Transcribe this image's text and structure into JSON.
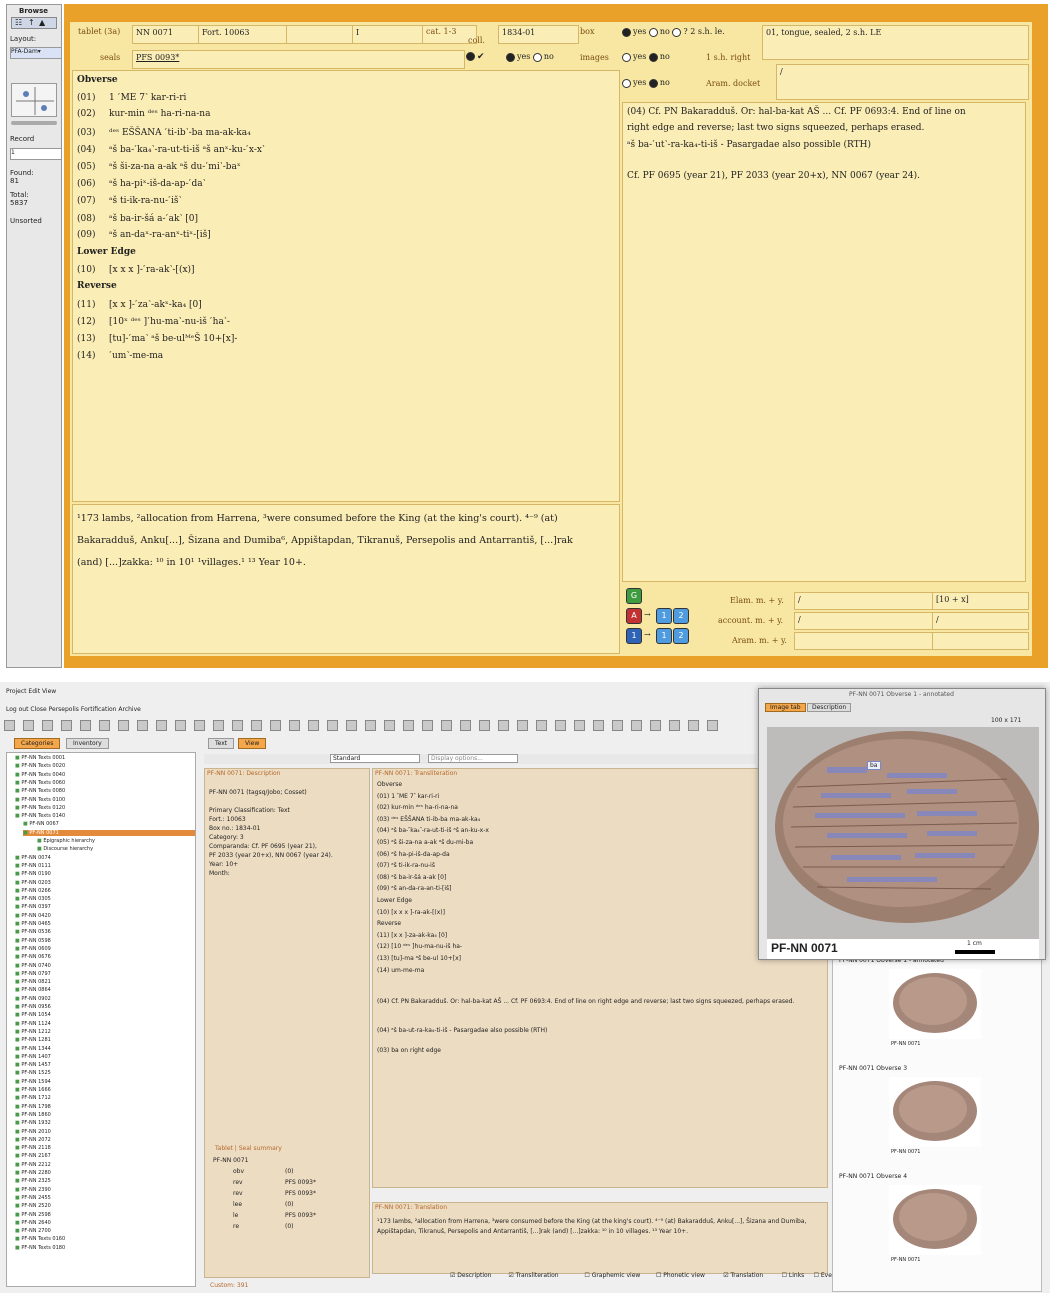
{
  "top": {
    "sidebar": {
      "browse": "Browse",
      "layout": "Layout:",
      "layout_value": "PFA-Dam▾",
      "record": "Record",
      "record_value": "1",
      "found_label": "Found:",
      "found_value": "81",
      "total_label": "Total:",
      "total_value": "5837",
      "unsorted": "Unsorted"
    },
    "header": {
      "tablet_label": "tablet (3a)",
      "tablet_value": "NN 0071",
      "fort_value": "Fort. 10063",
      "i_value": "I",
      "cat_label": "cat. 1-3",
      "coll_label": "coll.",
      "date_value": "1834-01",
      "box_label": "box",
      "seals_label": "seals",
      "seals_value": "PFS 0093*",
      "images_label": "images",
      "yes": "yes",
      "no": "no",
      "q2sh": "? 2 s.h. le.",
      "right_desc": "01, tongue, sealed, 2 s.h. LE",
      "one_sh_right": "1 s.h. right",
      "aram_docket": "Aram. docket",
      "aram_value": "/"
    },
    "transliteration": [
      {
        "n": "Obverse",
        "t": "",
        "h": true
      },
      {
        "n": "(01)",
        "t": "1 ˹ME 7˺ kar-ri-ri"
      },
      {
        "n": "(02)",
        "t": "kur-min ᵈᵉˢ ha-ri-na-na"
      },
      {
        "n": "(03)",
        "t": "ᵈᵉˢ EŠŠANA ˹ti-ib˺-ba ma-ak-ka₄"
      },
      {
        "n": "(04)",
        "t": "ᵃš ba-˹ka₄˺-ra-ut-ti-iš ᵃš anˣ-ku-˹x-x˺"
      },
      {
        "n": "(05)",
        "t": "ᵃš ši-za-na a-ak ᵃš du-˹mi˺-baˣ"
      },
      {
        "n": "(06)",
        "t": "ᵃš ha-piˣ-iš-da-ap-˹da˺"
      },
      {
        "n": "(07)",
        "t": "ᵃš ti-ik-ra-nu-˹iš˺"
      },
      {
        "n": "(08)",
        "t": "ᵃš ba-ir-šá a-˹ak˺ [0]"
      },
      {
        "n": "(09)",
        "t": "ᵃš an-daˣ-ra-anˣ-tiˣ-[iš]"
      },
      {
        "n": "Lower Edge",
        "t": "",
        "h": true
      },
      {
        "n": "(10)",
        "t": "[x x x ]-˹ra-ak˺-[(x)]"
      },
      {
        "n": "Reverse",
        "t": "",
        "h": true
      },
      {
        "n": "(11)",
        "t": "[x x ]-˹za˺-akˣ-ka₄ [0]"
      },
      {
        "n": "(12)",
        "t": "[10ˣ ᵈᵉˢ ]˹hu-ma˺-nu-iš ˹ha˺-"
      },
      {
        "n": "(13)",
        "t": "[tu]-˹ma˺ ᵃš be-ulᴹᵉŠ 10+[x]-"
      },
      {
        "n": "(14)",
        "t": "˹um˺-me-ma"
      }
    ],
    "translation": [
      "¹173 lambs, ²allocation from Harrena, ³were consumed before the King (at the king's court). ⁴⁻⁹ (at)",
      "Bakaradduš, Anku[...], Šizana and Dumiba⁶, Appištapdan, Tikranuš, Persepolis and Antarrantiš, [...]rak",
      "(and) [...]zakka: ¹⁰ in 10¹ ¹villages.¹ ¹³ Year 10+."
    ],
    "notes": [
      "(04) Cf. PN Bakaradduš. Or: hal-ba-kat AŠ ... Cf. PF 0693:4. End of line on",
      "right edge and reverse; last two signs squeezed, perhaps erased.",
      "ᵃš ba-˹ut˺-ra-ka₄-ti-iš - Pasargadae also possible (RTH)",
      "",
      "Cf. PF 0695 (year 21), PF 2033 (year 20+x), NN 0067 (year 24)."
    ],
    "counts": {
      "elam_label": "Elam. m. + y.",
      "elam_value": "/",
      "elam_right": "[10 + x]",
      "account_label": "account. m. + y.",
      "account_value": "/",
      "account_right": "/",
      "aram_label": "Aram. m. + y.",
      "aram_value": ""
    },
    "buttons": {
      "g": "G",
      "a": "A",
      "b": "1",
      "one": "1",
      "two": "2"
    }
  },
  "bottom": {
    "menubar": "Project   Edit   View",
    "toolbar2": "Log out     Close Persepolis Fortification Archive",
    "tabs": [
      "Categories",
      "Inventory"
    ],
    "subtabs": [
      "Text",
      "View"
    ],
    "dropdown": "Standard",
    "search_placeholder": "Display options...",
    "tree_items": [
      "PF-NN Texts 0001",
      "PF-NN Texts 0020",
      "PF-NN Texts 0040",
      "PF-NN Texts 0060",
      "PF-NN Texts 0080",
      "PF-NN Texts 0100",
      "PF-NN Texts 0120",
      "PF-NN Texts 0140",
      "PF-NN 0067",
      "PF-NN 0071",
      "Epigraphic hierarchy",
      "Discourse hierarchy",
      "PF-NN 0074",
      "PF-NN 0111",
      "PF-NN 0190",
      "PF-NN 0203",
      "PF-NN 0266",
      "PF-NN 0305",
      "PF-NN 0397",
      "PF-NN 0420",
      "PF-NN 0465",
      "PF-NN 0536",
      "PF-NN 0598",
      "PF-NN 0609",
      "PF-NN 0676",
      "PF-NN 0740",
      "PF-NN 0797",
      "PF-NN 0821",
      "PF-NN 0864",
      "PF-NN 0902",
      "PF-NN 0956",
      "PF-NN 1054",
      "PF-NN 1124",
      "PF-NN 1212",
      "PF-NN 1281",
      "PF-NN 1344",
      "PF-NN 1407",
      "PF-NN 1457",
      "PF-NN 1525",
      "PF-NN 1594",
      "PF-NN 1666",
      "PF-NN 1712",
      "PF-NN 1798",
      "PF-NN 1860",
      "PF-NN 1932",
      "PF-NN 2010",
      "PF-NN 2072",
      "PF-NN 2118",
      "PF-NN 2167",
      "PF-NN 2212",
      "PF-NN 2280",
      "PF-NN 2325",
      "PF-NN 2390",
      "PF-NN 2455",
      "PF-NN 2520",
      "PF-NN 2598",
      "PF-NN 2640",
      "PF-NN 2700",
      "PF-NN Texts 0160",
      "PF-NN Texts 0180"
    ],
    "left_panel_title": "PF-NN 0071: Description",
    "left_panel_lines": [
      "PF-NN 0071 (tagsq/Jobo; Cosset)",
      "",
      "Primary Classification: Text",
      "  Fort.: 10063",
      "  Box no.: 1834-01",
      "  Category: 3",
      "  Comparanda: Cf. PF 0695 (year 21),",
      "PF 2033 (year 20+x), NN 0067 (year 24).",
      "  Year: 10+",
      "  Month:"
    ],
    "seal_panel_title": "Tablet | Seal summary",
    "seal_rows": [
      [
        "PF-NN 0071",
        ""
      ],
      [
        "obv",
        "(0)"
      ],
      [
        "rev",
        "PFS 0093*"
      ],
      [
        "rev",
        "PFS 0093*"
      ],
      [
        "lee",
        "(0)"
      ],
      [
        "le",
        "PFS 0093*"
      ],
      [
        "re",
        "(0)"
      ]
    ],
    "center_panel_title": "PF-NN 0071: Transliteration",
    "center_lines": [
      "Obverse",
      "(01) 1 ˹ME 7˺ kar-ri-ri",
      "(02) kur-min ᵈᵉˢ ha-ri-na-na",
      "(03) ᵈᵉˢ EŠŠANA ti-ib-ba ma-ak-ka₄",
      "(04) ᵃš ba-˹ka₄˺-ra-ut-ti-iš ᵃš an-ku-x-x",
      "(05) ᵃš ši-za-na a-ak ᵃš du-mi-ba",
      "(06) ᵃš ha-pi-iš-da-ap-da",
      "(07) ᵃš ti-ik-ra-nu-iš",
      "(08) ᵃš ba-ir-šá a-ak [0]",
      "(09) ᵃš an-da-ra-an-ti-[iš]",
      "Lower Edge",
      "(10) [x x x ]-ra-ak-[(x)]",
      "Reverse",
      "(11) [x x ]-za-ak-ka₄ [0]",
      "(12) [10 ᵈᵉˢ ]hu-ma-nu-iš ha-",
      "(13) [tu]-ma ᵃš be-ul 10+[x]",
      "(14) um-me-ma"
    ],
    "center_note_1": "(04) Cf. PN Bakaradduš. Or: hal-ba-kat AŠ ... Cf. PF 0693:4. End of line on right edge and reverse; last two signs squeezed, perhaps erased.",
    "center_note_2": "(04) ᵃš ba-ut-ra-ka₄-ti-iš - Pasargadae also possible (RTH)",
    "center_note_3": "(03) ba on right edge",
    "translation_title": "PF-NN 0071: Translation",
    "translation_text": "¹173 lambs, ²allocation from Harrena, ³were consumed before the King (at the king's court). ⁴⁻⁹ (at) Bakaradduš, Anku[...], Šizana and Dumiba, Appištapdan, Tikranuš, Persepolis and Antarrantiš, [...]rak (and) [...]zakka: ¹⁰ in 10 villages. ¹³ Year 10+.",
    "checkbox_bar": [
      "Description",
      "Transliteration",
      "Graphemic view",
      "Phonetic view",
      "Translation",
      "Links",
      "Events"
    ],
    "bottom_label": "Custom: 391",
    "image_window_title": "PF-NN 0071 Obverse 1 - annotated",
    "image_tabs": [
      "Image tab",
      "Description"
    ],
    "zoom": "100 x 171",
    "tablet_caption": "PF-NN 0071",
    "scale_label": "1 cm",
    "label_ba": "ba",
    "thumbs": [
      {
        "title": "PF-NN 0071 Obverse 1 - annotated",
        "caption": "PF-NN 0071"
      },
      {
        "title": "PF-NN 0071 Obverse 3",
        "caption": "PF-NN 0071"
      },
      {
        "title": "PF-NN 0071 Obverse 4",
        "caption": "PF-NN 0071"
      }
    ]
  }
}
